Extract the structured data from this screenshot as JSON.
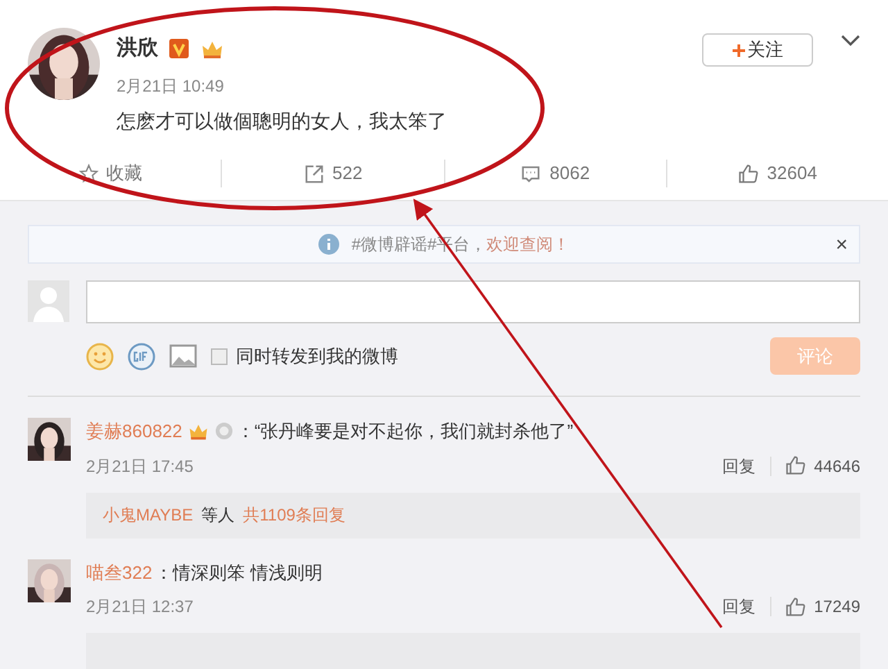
{
  "post": {
    "author": "洪欣",
    "time": "2月21日 10:49",
    "text": "怎麽才可以做個聰明的女人，我太笨了",
    "follow_label": "关注",
    "actions": [
      {
        "kind": "favorite",
        "label": "收藏"
      },
      {
        "kind": "repost",
        "label": "522"
      },
      {
        "kind": "comment",
        "label": "8062"
      },
      {
        "kind": "like",
        "label": "32604"
      }
    ]
  },
  "notice": {
    "text": "#微博辟谣#平台，",
    "link": "欢迎查阅！",
    "close": "×"
  },
  "composer": {
    "checkbox_label": "同时转发到我的微博",
    "checked": false,
    "submit": "评论"
  },
  "comments": [
    {
      "user": "姜赫860822",
      "badges": true,
      "text": "：“张丹峰要是对不起你，我们就封杀他了”",
      "time": "2月21日 17:45",
      "reply": "回复",
      "likes": "44646",
      "thread": {
        "names": "小鬼MAYBE",
        "middle": "等人",
        "count": "共1109条回复"
      }
    },
    {
      "user": "喵叁322",
      "badges": false,
      "text": "：情深则笨 情浅则明",
      "time": "2月21日 12:37",
      "reply": "回复",
      "likes": "17249"
    }
  ]
}
